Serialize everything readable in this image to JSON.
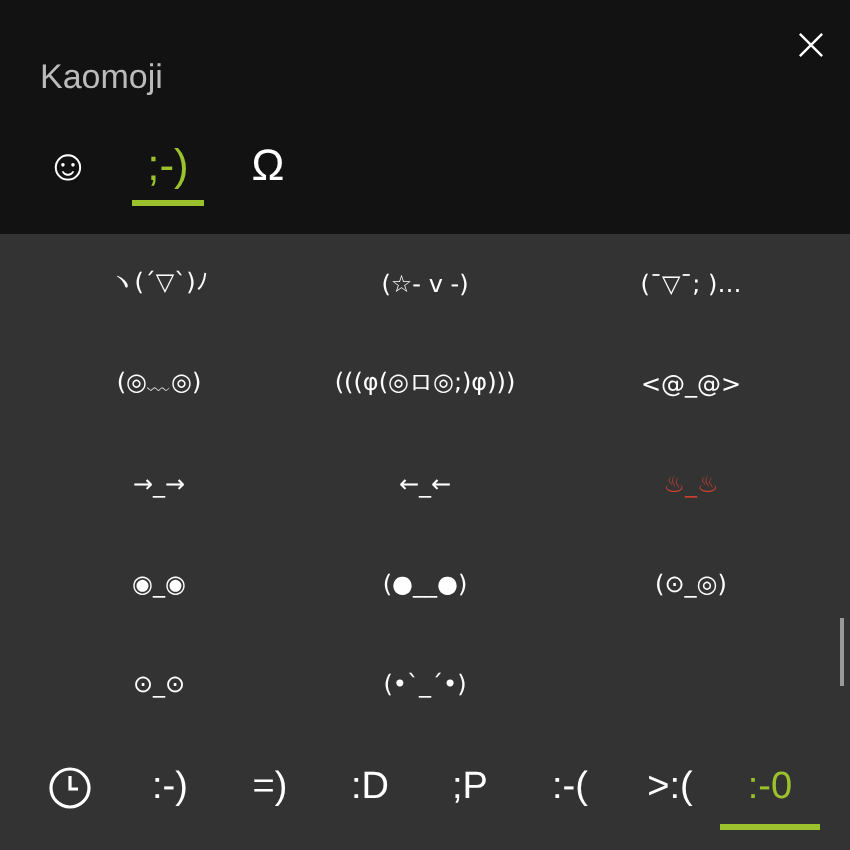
{
  "window": {
    "title": "Kaomoji"
  },
  "tabs": [
    {
      "label": "☺",
      "selected": false
    },
    {
      "label": ";-)",
      "selected": true
    },
    {
      "label": "Ω",
      "selected": false
    }
  ],
  "kaomoji": [
    {
      "text": "ヽ(ˊ▽ˋ)ﾉ"
    },
    {
      "text": "(☆- v -)"
    },
    {
      "text": "(¯▽¯; )…"
    },
    {
      "text": "(◎﹏◎)"
    },
    {
      "text": "(((φ(◎ロ◎;)φ)))"
    },
    {
      "text": "<@_@>"
    },
    {
      "text": "→_→"
    },
    {
      "text": "←_←"
    },
    {
      "text": "♨_♨",
      "color": "#c8402e"
    },
    {
      "text": "◉_◉"
    },
    {
      "text": "(●__●)"
    },
    {
      "text": "(⊙_◎)"
    },
    {
      "text": "⊙_⊙"
    },
    {
      "text": "(•`_´•)"
    }
  ],
  "categories": [
    {
      "kind": "recent",
      "selected": false
    },
    {
      "kind": "text",
      "label": ":-)",
      "selected": false
    },
    {
      "kind": "text",
      "label": "=)",
      "selected": false
    },
    {
      "kind": "text",
      "label": ":D",
      "selected": false
    },
    {
      "kind": "text",
      "label": ";P",
      "selected": false
    },
    {
      "kind": "text",
      "label": ":-(",
      "selected": false
    },
    {
      "kind": "text",
      "label": ">:(",
      "selected": false
    },
    {
      "kind": "text",
      "label": ":-0",
      "selected": true
    }
  ]
}
